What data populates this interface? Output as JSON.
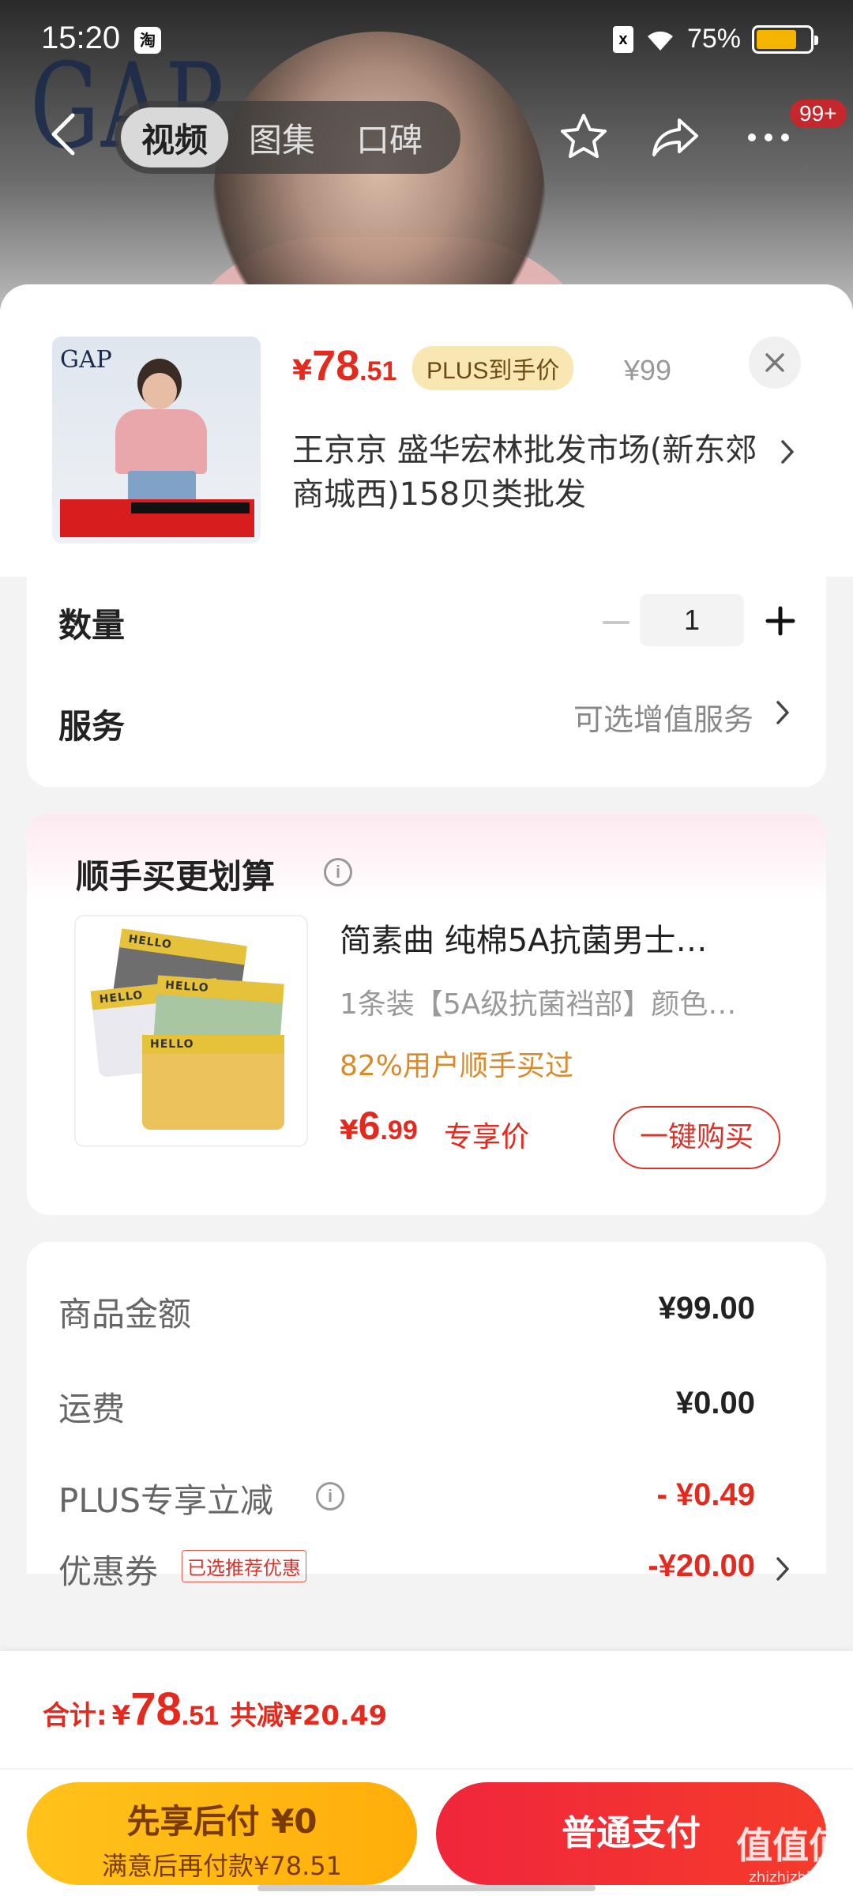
{
  "status_bar": {
    "time": "15:20",
    "app_badge": "淘",
    "sim_icon": "x",
    "battery_percent": "75%",
    "battery_level": 0.75
  },
  "nav": {
    "tabs": [
      {
        "label": "视频",
        "active": true
      },
      {
        "label": "图集",
        "active": false
      },
      {
        "label": "口碑",
        "active": false
      }
    ],
    "more_badge": "99+",
    "background_logo": "GAP"
  },
  "product": {
    "thumb_logo": "GAP",
    "price_yen": "¥",
    "price_int": "78",
    "price_dec": ".51",
    "plus_tag": "PLUS到手价",
    "original_price": "¥99",
    "address": "王京京  盛华宏林批发市场(新东郊商城西)158贝类批发"
  },
  "quantity": {
    "label": "数量",
    "value": "1"
  },
  "service": {
    "label": "服务",
    "value": "可选增值服务"
  },
  "addon": {
    "title": "顺手买更划算",
    "name": "简素曲 纯棉5A抗菌男士…",
    "spec": "1条装【5A级抗菌裆部】颜色…",
    "social_proof": "82%用户顺手买过",
    "price_yen": "¥",
    "price_int": "6",
    "price_dec": ".99",
    "price_tag": "专享价",
    "buy_button": "一键购买",
    "brief_brand": "HELLO"
  },
  "summary": {
    "rows": [
      {
        "label": "商品金额",
        "value": "¥99.00"
      },
      {
        "label": "运费",
        "value": "¥0.00"
      },
      {
        "label": "PLUS专享立减",
        "value": "- ¥0.49"
      },
      {
        "label": "优惠券",
        "value": "-¥20.00"
      }
    ],
    "coupon_tag": "已选推荐优惠"
  },
  "bottom": {
    "total_label": "合计:",
    "total_yen": "¥",
    "total_int": "78",
    "total_dec": ".51",
    "saved": "共减¥20.49",
    "pay_later_line1": "先享后付 ¥0",
    "pay_later_line2": "满意后再付款¥78.51",
    "pay_normal": "普通支付"
  },
  "watermark": {
    "text": "值值值",
    "sub": "zhizhizhi.com"
  },
  "colors": {
    "accent_red": "#e22a1f",
    "pay_yellow": "#ffc21b",
    "pay_red": "#f0263c",
    "plus_gold": "#f8e7b3"
  }
}
